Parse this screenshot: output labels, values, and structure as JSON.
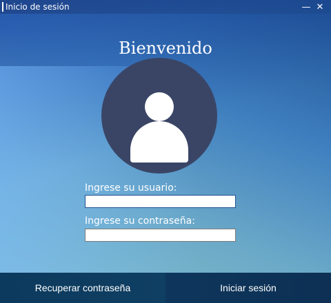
{
  "window": {
    "title": "Inicio de sesión",
    "minimize_glyph": "—",
    "close_glyph": "✕"
  },
  "heading": "Bienvenido",
  "avatar": {
    "icon": "user-icon"
  },
  "fields": {
    "username": {
      "label": "Ingrese su usuario:",
      "value": "",
      "placeholder": ""
    },
    "password": {
      "label": "Ingrese su contraseña:",
      "value": "",
      "placeholder": ""
    }
  },
  "buttons": {
    "recover": "Recuperar contraseña",
    "login": "Iniciar sesión"
  },
  "colors": {
    "avatar_bg": "#3a4566",
    "bottom_bar": "#0d3858",
    "text": "#ffffff"
  }
}
